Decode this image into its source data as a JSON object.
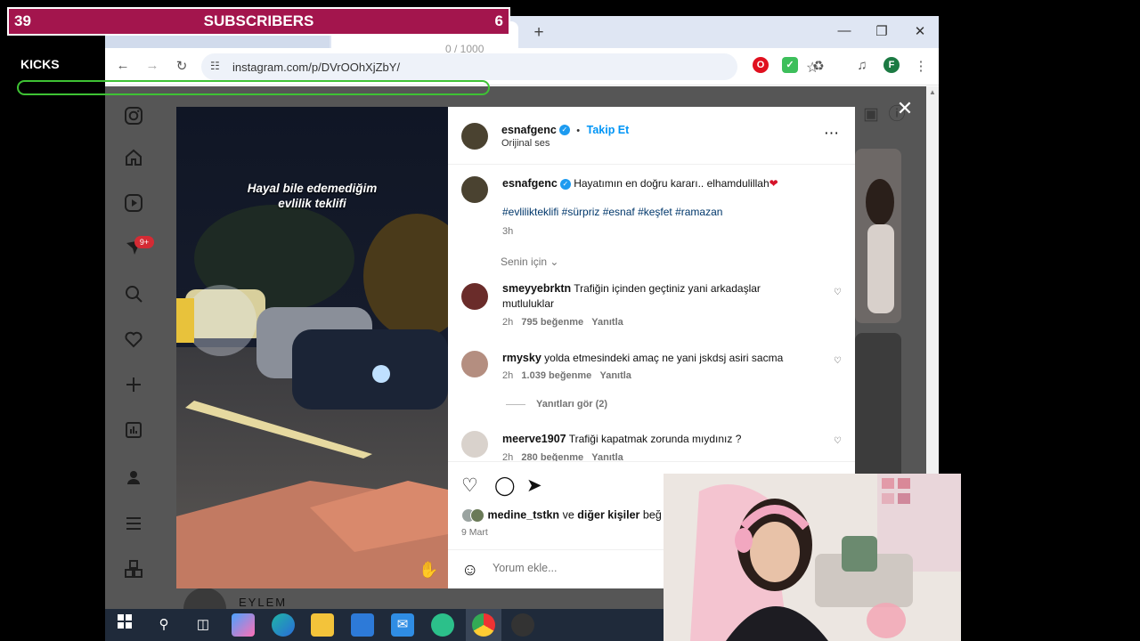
{
  "overlay": {
    "left_count": "39",
    "title": "SUBSCRIBERS",
    "right_count": "6",
    "kicks_label": "KICKS",
    "char_counter": "0 / 1000",
    "kicks_bar_color": "#3ec234",
    "subscribers_bg": "#a3154d"
  },
  "browser": {
    "url": "instagram.com/p/DVrOOhXjZbY/",
    "profile_initial": "F",
    "new_tab_label": "+"
  },
  "instagram": {
    "nav_icons": [
      "instagram-icon",
      "home-icon",
      "reels-icon",
      "messages-icon",
      "search-icon",
      "heart-icon",
      "create-icon",
      "insights-icon",
      "profile-icon",
      "menu-icon",
      "apps-icon"
    ],
    "notification_badge": "9+",
    "below_profile_name": "EYLEM",
    "video_caption_line1": "Hayal bile edemediğim",
    "video_caption_line2": "evlilik teklifi",
    "post": {
      "author": "esnafgenc",
      "separator": "•",
      "follow_label": "Takip Et",
      "audio": "Orijinal ses",
      "caption": "Hayatımın en doğru kararı.. elhamdulillah",
      "caption_emoji": "❤",
      "hashtags": "#evlilikteklifi #sürpriz #esnaf #keşfet #ramazan",
      "time": "3h",
      "sort_label": "Senin için",
      "comments": [
        {
          "user": "smeyyebrktn",
          "text": "Trafiğin içinden geçtiniz yani arkadaşlar mutluluklar",
          "time": "2h",
          "likes": "795 beğenme",
          "reply": "Yanıtla"
        },
        {
          "user": "rmysky",
          "text": "yolda etmesindeki amaç ne yani jskdsj asiri sacma",
          "time": "2h",
          "likes": "1.039 beğenme",
          "reply": "Yanıtla"
        },
        {
          "user": "meerve1907",
          "text": "Trafiği kapatmak zorunda mıydınız ?",
          "time": "2h",
          "likes": "280 beğenme",
          "reply": "Yanıtla"
        }
      ],
      "view_replies": "Yanıtları gör (2)",
      "liked_by_user": "medine_tstkn",
      "liked_by_and": "ve",
      "liked_by_others": "diğer kişiler",
      "liked_by_suffix": "beğ",
      "date": "9 Mart",
      "comment_placeholder": "Yorum ekle..."
    }
  },
  "taskbar": {
    "icons": [
      "windows-start-icon",
      "search-icon",
      "task-view-icon",
      "copilot-icon",
      "edge-icon",
      "file-explorer-icon",
      "store-icon",
      "mail-icon",
      "chatgpt-icon",
      "chrome-icon",
      "obs-icon"
    ]
  }
}
